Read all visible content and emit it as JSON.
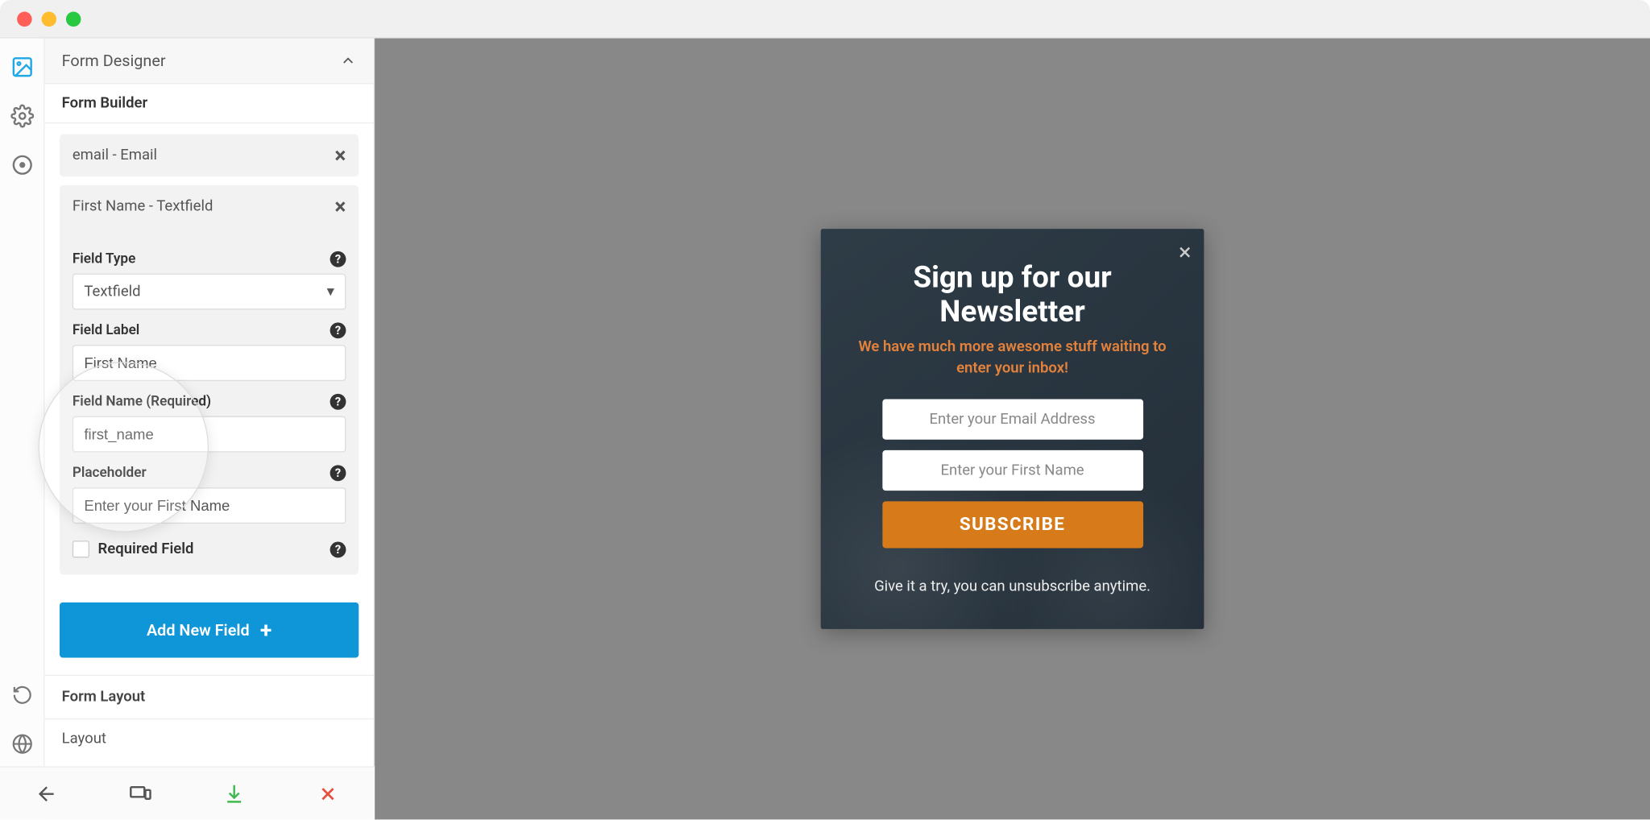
{
  "sidebar": {
    "panel_title": "Form Designer",
    "section_title": "Form Builder",
    "field_items": [
      {
        "label": "email - Email"
      },
      {
        "label": "First Name - Textfield"
      }
    ],
    "props": {
      "field_type_label": "Field Type",
      "field_type_value": "Textfield",
      "field_label_label": "Field Label",
      "field_label_value": "First Name",
      "field_name_label": "Field Name (Required)",
      "field_name_value": "first_name",
      "placeholder_label": "Placeholder",
      "placeholder_value": "Enter your First Name",
      "required_label": "Required Field"
    },
    "add_button": "Add New Field",
    "form_layout_title": "Form Layout",
    "layout_label": "Layout"
  },
  "modal": {
    "title_l1": "Sign up for our",
    "title_l2": "Newsletter",
    "subtitle": "We have much more awesome stuff waiting to enter your inbox!",
    "email_ph": "Enter your Email Address",
    "name_ph": "Enter your First Name",
    "button": "SUBSCRIBE",
    "footer": "Give it a try, you can unsubscribe anytime."
  }
}
